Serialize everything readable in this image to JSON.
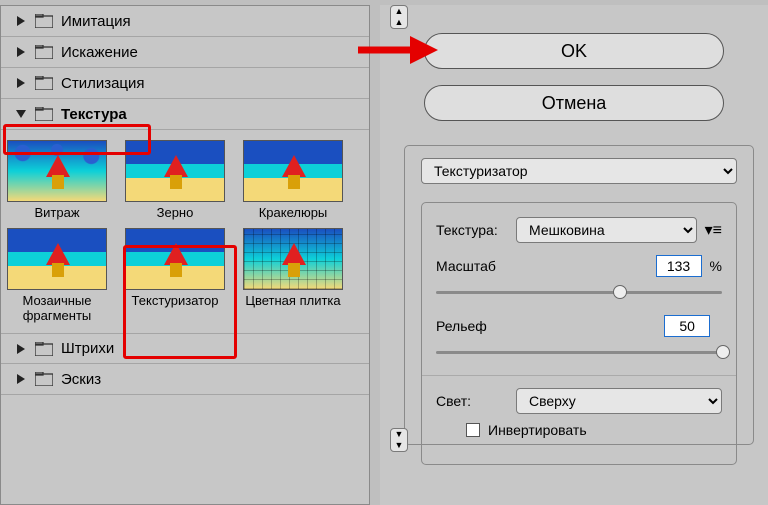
{
  "tree": [
    {
      "label": "Имитация",
      "expanded": false
    },
    {
      "label": "Искажение",
      "expanded": false
    },
    {
      "label": "Стилизация",
      "expanded": false
    },
    {
      "label": "Текстура",
      "expanded": true
    },
    {
      "label": "Штрихи",
      "expanded": false
    },
    {
      "label": "Эскиз",
      "expanded": false
    }
  ],
  "thumbs": [
    {
      "label": "Витраж"
    },
    {
      "label": "Зерно"
    },
    {
      "label": "Кракелюры"
    },
    {
      "label": "Мозаичные фрагменты"
    },
    {
      "label": "Текстуризатор"
    },
    {
      "label": "Цветная плитка"
    }
  ],
  "buttons": {
    "ok": "OK",
    "cancel": "Отмена"
  },
  "filter_select": "Текстуризатор",
  "params": {
    "texture_label": "Текстура:",
    "texture_value": "Мешковина",
    "scale_label": "Масштаб",
    "scale_value": "133",
    "scale_unit": "%",
    "relief_label": "Рельеф",
    "relief_value": "50",
    "light_label": "Свет:",
    "light_value": "Сверху",
    "invert_label": "Инвертировать"
  },
  "slider_positions": {
    "scale_pct": 62,
    "relief_pct": 98
  }
}
